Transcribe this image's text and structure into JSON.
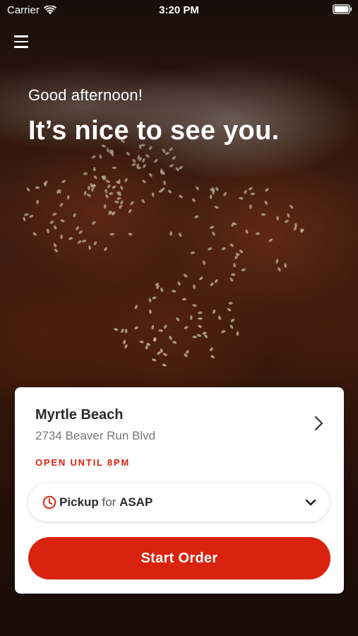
{
  "status_bar": {
    "carrier": "Carrier",
    "time": "3:20 PM"
  },
  "greeting": {
    "salutation": "Good afternoon!",
    "headline": "It’s nice to see you."
  },
  "location": {
    "name": "Myrtle Beach",
    "address": "2734 Beaver Run Blvd",
    "hours": "OPEN UNTIL 8PM"
  },
  "order_mode": {
    "type": "Pickup",
    "connector": "for",
    "time": "ASAP"
  },
  "actions": {
    "start_order": "Start Order"
  },
  "colors": {
    "accent": "#d9230f",
    "card": "#ffffff",
    "text_primary": "#2b2b2b",
    "text_secondary": "#777777"
  },
  "icons": {
    "menu": "hamburger-menu-icon",
    "wifi": "wifi-icon",
    "battery": "battery-icon",
    "location_chevron": "chevron-right-icon",
    "clock": "clock-icon",
    "dropdown": "chevron-down-icon"
  }
}
